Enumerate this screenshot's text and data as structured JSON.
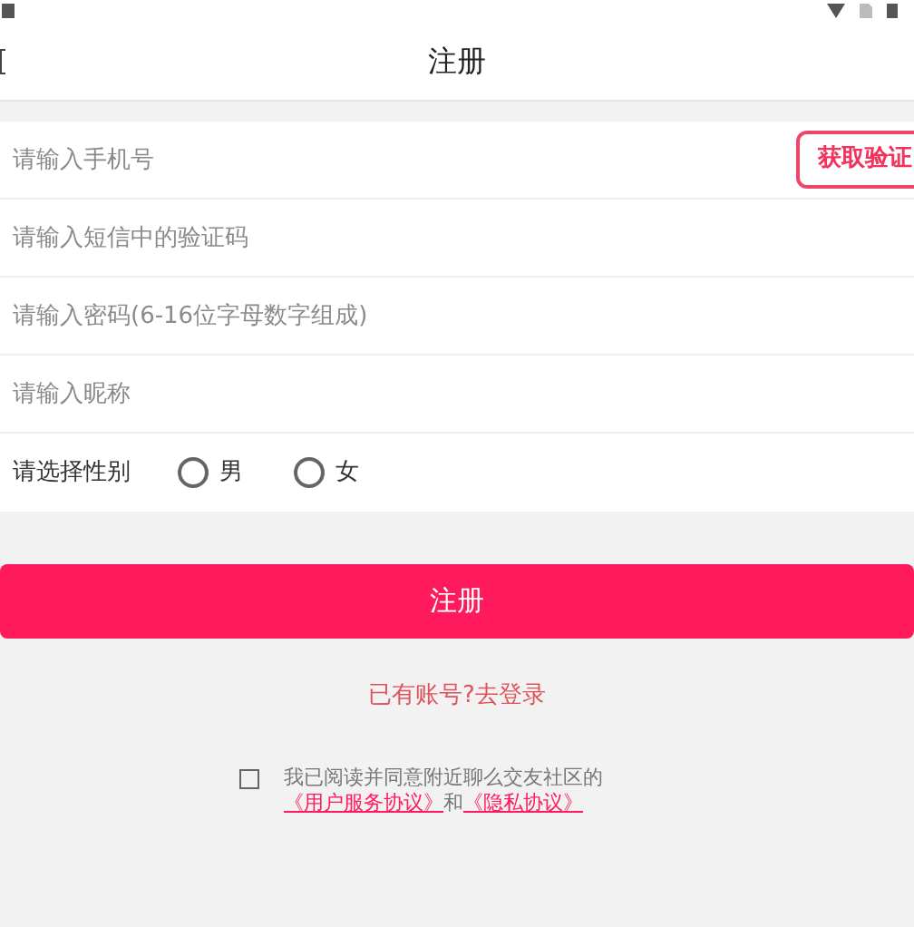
{
  "header": {
    "title": "注册"
  },
  "form": {
    "phone": {
      "placeholder": "请输入手机号"
    },
    "code_button": "获取验证",
    "sms_code": {
      "placeholder": "请输入短信中的验证码"
    },
    "password": {
      "placeholder": "请输入密码(6-16位字母数字组成)"
    },
    "nickname": {
      "placeholder": "请输入昵称"
    },
    "gender": {
      "label": "请选择性别",
      "options": [
        {
          "label": "男",
          "selected": false
        },
        {
          "label": "女",
          "selected": false
        }
      ]
    }
  },
  "register_button": "注册",
  "login_link": "已有账号?去登录",
  "agreement": {
    "checked": false,
    "text": "我已阅读并同意附近聊么交友社区的",
    "user_agreement": "《用户服务协议》",
    "and": "和",
    "privacy": "《隐私协议》"
  }
}
